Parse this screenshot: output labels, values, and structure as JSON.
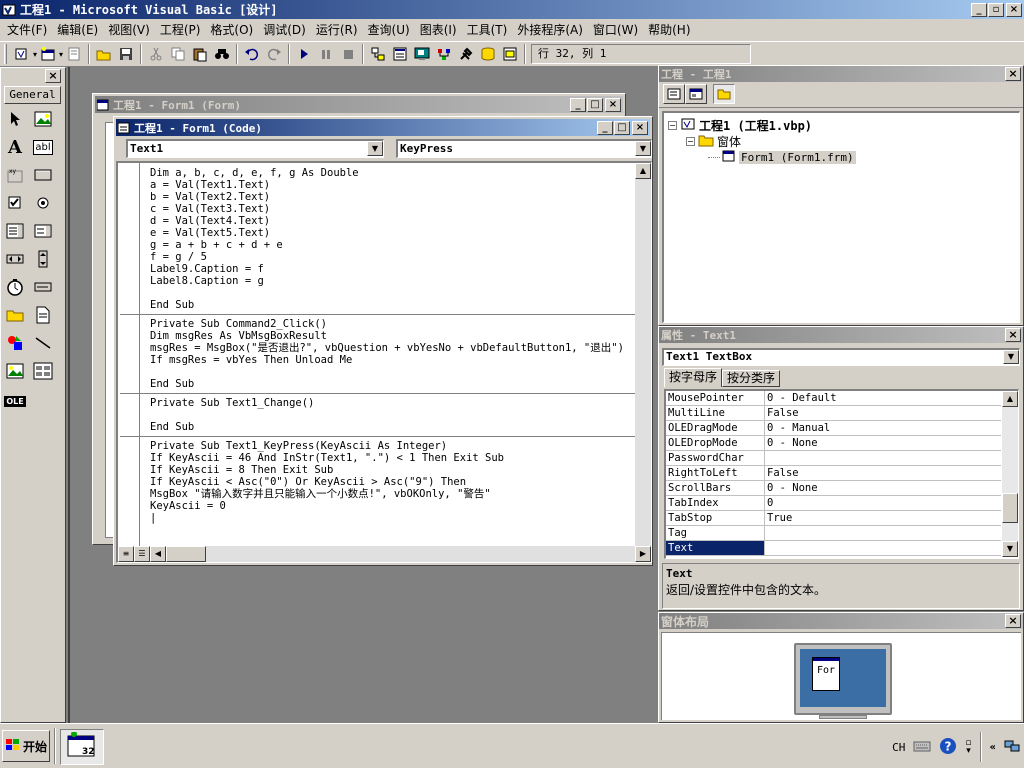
{
  "app": {
    "title": "工程1 - Microsoft Visual Basic [设计]",
    "title_icon": "vb-app-icon"
  },
  "menu": [
    "文件(F)",
    "编辑(E)",
    "视图(V)",
    "工程(P)",
    "格式(O)",
    "调试(D)",
    "运行(R)",
    "查询(U)",
    "图表(I)",
    "工具(T)",
    "外接程序(A)",
    "窗口(W)",
    "帮助(H)"
  ],
  "toolbar": {
    "position": "行 32, 列 1"
  },
  "toolbox": {
    "tab_label": "General"
  },
  "form_window": {
    "title": "工程1 - Form1 (Form)"
  },
  "code_window": {
    "title": "工程1 - Form1 (Code)",
    "object_combo": "Text1",
    "procedure_combo": "KeyPress",
    "procedures": [
      [
        "Dim a, b, c, d, e, f, g As Double",
        "a = Val(Text1.Text)",
        "b = Val(Text2.Text)",
        "c = Val(Text3.Text)",
        "d = Val(Text4.Text)",
        "e = Val(Text5.Text)",
        "g = a + b + c + d + e",
        "f = g / 5",
        "Label9.Caption = f",
        "Label8.Caption = g",
        "",
        "End Sub"
      ],
      [
        "Private Sub Command2_Click()",
        "Dim msgRes As VbMsgBoxResult",
        "msgRes = MsgBox(\"是否退出?\", vbQuestion + vbYesNo + vbDefaultButton1, \"退出\")",
        "If msgRes = vbYes Then Unload Me",
        "",
        "End Sub"
      ],
      [
        "Private Sub Text1_Change()",
        "",
        "End Sub"
      ],
      [
        "Private Sub Text1_KeyPress(KeyAscii As Integer)",
        "If KeyAscii = 46 And InStr(Text1, \".\") < 1 Then Exit Sub",
        "If KeyAscii = 8 Then Exit Sub",
        "If KeyAscii < Asc(\"0\") Or KeyAscii > Asc(\"9\") Then",
        "MsgBox \"请输入数字并且只能输入一个小数点!\", vbOKOnly, \"警告\"",
        "KeyAscii = 0",
        "|"
      ]
    ]
  },
  "project": {
    "title": "工程 - 工程1",
    "root": "工程1 (工程1.vbp)",
    "folder": "窗体",
    "form": "Form1 (Form1.frm)"
  },
  "properties": {
    "title": "属性 - Text1",
    "object": "Text1 TextBox",
    "tabs": [
      "按字母序",
      "按分类序"
    ],
    "rows": [
      {
        "name": "MousePointer",
        "value": "0 - Default"
      },
      {
        "name": "MultiLine",
        "value": "False"
      },
      {
        "name": "OLEDragMode",
        "value": "0 - Manual"
      },
      {
        "name": "OLEDropMode",
        "value": "0 - None"
      },
      {
        "name": "PasswordChar",
        "value": ""
      },
      {
        "name": "RightToLeft",
        "value": "False"
      },
      {
        "name": "ScrollBars",
        "value": "0 - None"
      },
      {
        "name": "TabIndex",
        "value": "0"
      },
      {
        "name": "TabStop",
        "value": "True"
      },
      {
        "name": "Tag",
        "value": ""
      },
      {
        "name": "Text",
        "value": ""
      }
    ],
    "desc_title": "Text",
    "desc_text": "返回/设置控件中包含的文本。"
  },
  "layout_window": {
    "title": "窗体布局",
    "form_label": "For"
  },
  "taskbar": {
    "start": "开始",
    "lang": "CH"
  },
  "colors": {
    "active_title": "#0a246a",
    "inactive_title": "#808080",
    "face": "#d4d0c8",
    "desktop": "#3a6ea5"
  }
}
